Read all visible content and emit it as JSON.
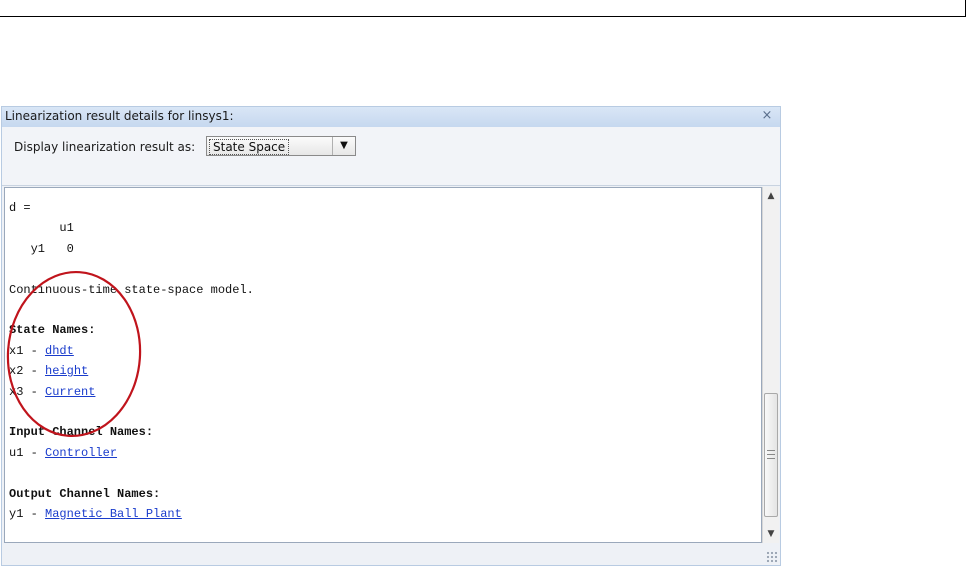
{
  "window": {
    "title": "Linearization result details for linsys1:",
    "close_icon": "×"
  },
  "options": {
    "display_label": "Display linearization result as:",
    "selected_format": "State Space",
    "dropdown_arrow": "▼"
  },
  "result": {
    "d_header": "d =",
    "d_col_header": "       u1",
    "d_row_label": "   y1",
    "d_row_value": "   0",
    "model_description": "Continuous-time state-space model.",
    "state_names_heading": "State Names:",
    "states": [
      {
        "prefix": "x1 - ",
        "name": "dhdt"
      },
      {
        "prefix": "x2 - ",
        "name": "height"
      },
      {
        "prefix": "x3 - ",
        "name": "Current"
      }
    ],
    "input_heading": "Input Channel Names:",
    "inputs": [
      {
        "prefix": "u1 - ",
        "name": "Controller"
      }
    ],
    "output_heading": "Output Channel Names:",
    "outputs": [
      {
        "prefix": "y1 - ",
        "name": "Magnetic Ball Plant"
      }
    ]
  },
  "scrollbar": {
    "up_icon": "▲",
    "down_icon": "▼"
  },
  "annotation": {
    "color": "#c0141c"
  }
}
